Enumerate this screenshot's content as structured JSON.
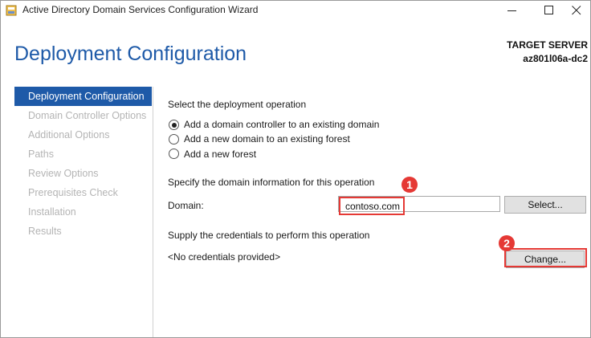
{
  "window": {
    "title": "Active Directory Domain Services Configuration Wizard"
  },
  "header": {
    "page_title": "Deployment Configuration",
    "target_server_label": "TARGET SERVER",
    "target_server_value": "az801l06a-dc2"
  },
  "nav": {
    "items": [
      {
        "label": "Deployment Configuration",
        "active": true
      },
      {
        "label": "Domain Controller Options",
        "active": false
      },
      {
        "label": "Additional Options",
        "active": false
      },
      {
        "label": "Paths",
        "active": false
      },
      {
        "label": "Review Options",
        "active": false
      },
      {
        "label": "Prerequisites Check",
        "active": false
      },
      {
        "label": "Installation",
        "active": false
      },
      {
        "label": "Results",
        "active": false
      }
    ]
  },
  "main": {
    "operation_heading": "Select the deployment operation",
    "operations": [
      {
        "label": "Add a domain controller to an existing domain",
        "selected": true
      },
      {
        "label": "Add a new domain to an existing forest",
        "selected": false
      },
      {
        "label": "Add a new forest",
        "selected": false
      }
    ],
    "domain_heading": "Specify the domain information for this operation",
    "domain_label": "Domain:",
    "domain_value": "contoso.com",
    "select_button": "Select...",
    "credentials_heading": "Supply the credentials to perform this operation",
    "credentials_value": "<No credentials provided>",
    "change_button": "Change..."
  },
  "annotations": {
    "callout_1": "1",
    "callout_2": "2",
    "highlight_color": "#e53935"
  },
  "colors": {
    "accent": "#1e5aa8",
    "nav_disabled": "#b4b4b4"
  }
}
